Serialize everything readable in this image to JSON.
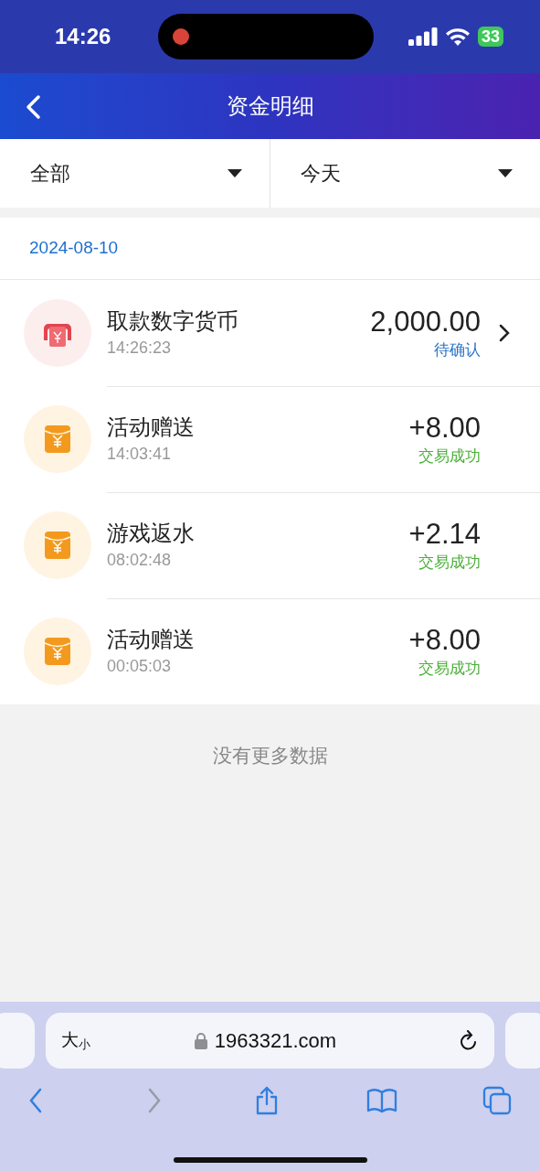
{
  "status_bar": {
    "time": "14:26",
    "battery": "33"
  },
  "header": {
    "title": "资金明细"
  },
  "filters": [
    {
      "label": "全部"
    },
    {
      "label": "今天"
    }
  ],
  "date": "2024-08-10",
  "records": [
    {
      "kind": "withdraw",
      "title": "取款数字货币",
      "time": "14:26:23",
      "amount": "2,000.00",
      "status": "待确认",
      "color": "#2a74c8",
      "has_arrow": true
    },
    {
      "kind": "bonus",
      "title": "活动赠送",
      "time": "14:03:41",
      "amount": "+8.00",
      "status": "交易成功",
      "color": "#4caf3a",
      "has_arrow": false
    },
    {
      "kind": "bonus",
      "title": "游戏返水",
      "time": "08:02:48",
      "amount": "+2.14",
      "status": "交易成功",
      "color": "#4caf3a",
      "has_arrow": false
    },
    {
      "kind": "bonus",
      "title": "活动赠送",
      "time": "00:05:03",
      "amount": "+8.00",
      "status": "交易成功",
      "color": "#4caf3a",
      "has_arrow": false
    }
  ],
  "footer": "没有更多数据",
  "browser": {
    "size_label": {
      "large": "大",
      "small": "小"
    },
    "url": "1963321.com",
    "toolbar": [
      {
        "kind": "back",
        "disabled": false
      },
      {
        "kind": "forward",
        "disabled": true
      },
      {
        "kind": "share",
        "disabled": false
      },
      {
        "kind": "bookmarks",
        "disabled": false
      },
      {
        "kind": "tabs",
        "disabled": false
      }
    ]
  }
}
